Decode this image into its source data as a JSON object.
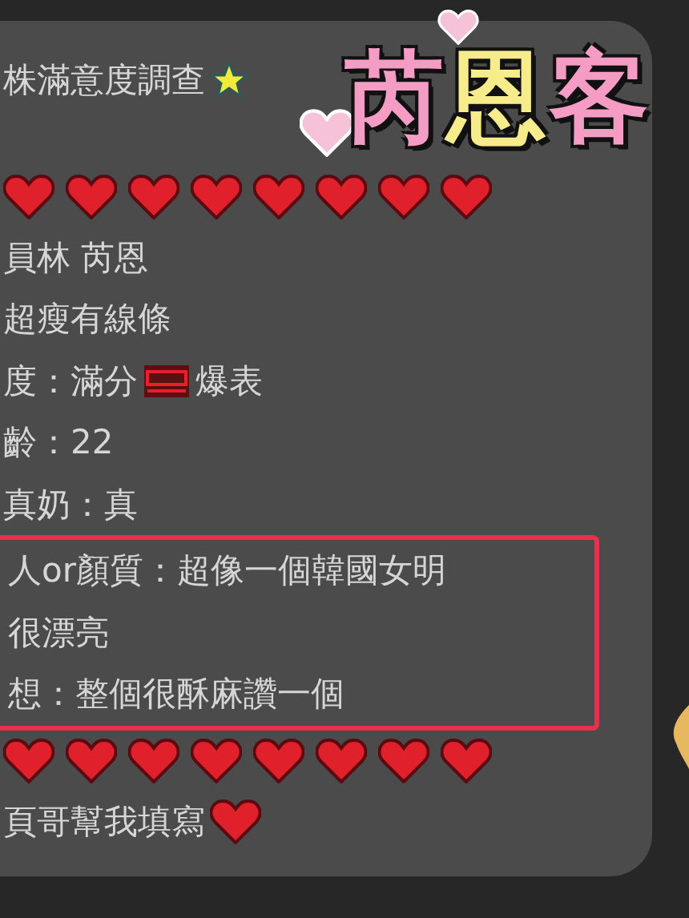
{
  "sticker": {
    "chars": [
      {
        "text": "芮",
        "color": "#f49cc4"
      },
      {
        "text": "恩",
        "color": "#f7ec8c"
      },
      {
        "text": "客",
        "color": "#f49cc4"
      }
    ]
  },
  "message": {
    "blocks": [
      {
        "kind": "plain",
        "lines": [
          {
            "kind": "starred",
            "text": "株滿意度調查"
          },
          {
            "kind": "hearts"
          },
          {
            "kind": "text",
            "text": "員林 芮恩"
          },
          {
            "kind": "text",
            "text": "超瘦有線條"
          },
          {
            "kind": "score",
            "text": "度：滿分",
            "after": "爆表"
          },
          {
            "kind": "text",
            "text": "齡：22"
          },
          {
            "kind": "text",
            "text": "真奶：真"
          }
        ]
      },
      {
        "kind": "highlight",
        "lines": [
          {
            "kind": "text",
            "text": "人or顏質：超像一個韓國女明"
          },
          {
            "kind": "text",
            "text": "很漂亮"
          },
          {
            "kind": "text",
            "text": "想：整個很酥麻讚一個"
          }
        ]
      },
      {
        "kind": "plain",
        "lines": [
          {
            "kind": "hearts"
          },
          {
            "kind": "hearted",
            "text": "頁哥幫我填寫"
          }
        ]
      }
    ]
  }
}
